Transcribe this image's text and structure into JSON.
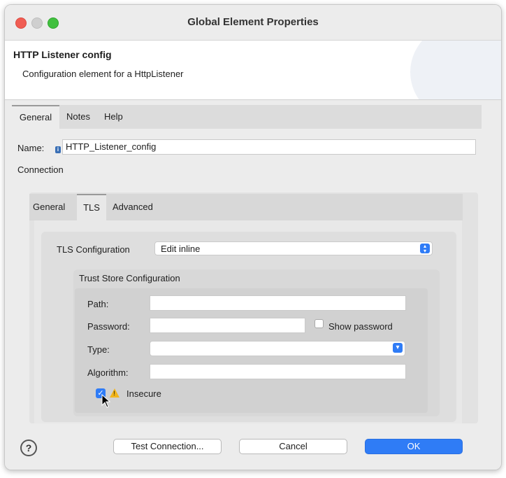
{
  "window": {
    "title": "Global Element Properties",
    "controls": [
      "close",
      "minimize",
      "maximize"
    ]
  },
  "header": {
    "title": "HTTP Listener config",
    "description": "Configuration element for a HttpListener"
  },
  "tabs": [
    {
      "label": "General",
      "active": true
    },
    {
      "label": "Notes",
      "active": false
    },
    {
      "label": "Help",
      "active": false
    }
  ],
  "name_field": {
    "label": "Name:",
    "value": "HTTP_Listener_config",
    "icon": "info-icon"
  },
  "connection": {
    "label": "Connection",
    "tabs": [
      {
        "label": "General",
        "active": false
      },
      {
        "label": "TLS",
        "active": true
      },
      {
        "label": "Advanced",
        "active": false
      }
    ]
  },
  "tls": {
    "label": "TLS Configuration",
    "selected": "Edit inline"
  },
  "trust_store": {
    "title": "Trust Store Configuration",
    "path_label": "Path:",
    "path_value": "",
    "password_label": "Password:",
    "password_value": "",
    "show_password_label": "Show password",
    "show_password_checked": false,
    "type_label": "Type:",
    "type_value": "",
    "algorithm_label": "Algorithm:",
    "algorithm_value": "",
    "insecure_label": "Insecure",
    "insecure_checked": true
  },
  "footer": {
    "test_connection": "Test Connection...",
    "cancel": "Cancel",
    "ok": "OK"
  },
  "colors": {
    "accent": "#2f7cf6",
    "close": "#f05d53",
    "maximize": "#41c03f"
  }
}
